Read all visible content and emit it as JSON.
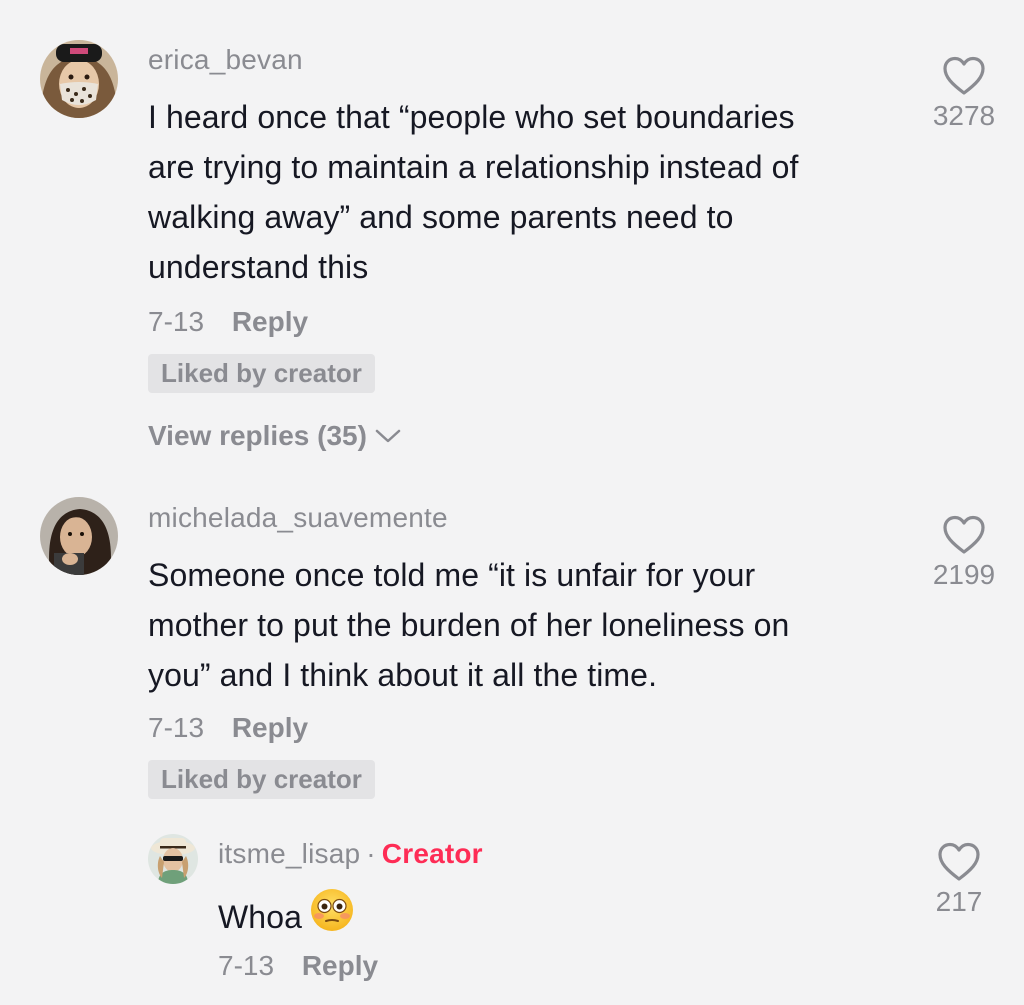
{
  "comments": [
    {
      "username": "erica_bevan",
      "text_lines": [
        "I heard once that “people who set boundaries",
        "are trying to maintain a relationship instead of",
        "walking away” and some parents need to",
        "understand this"
      ],
      "date": "7-13",
      "reply_label": "Reply",
      "liked_label": "Liked by creator",
      "view_replies_label": "View replies (35)",
      "like_count": "3278"
    },
    {
      "username": "michelada_suavemente",
      "text_lines": [
        "Someone once told me “it is unfair for your",
        "mother to put the burden of her loneliness on",
        "you” and I think about it all the time."
      ],
      "date": "7-13",
      "reply_label": "Reply",
      "liked_label": "Liked by creator",
      "like_count": "2199"
    }
  ],
  "reply": {
    "username": "itsme_lisap",
    "separator": "·",
    "creator_label": "Creator",
    "text": "Whoa",
    "emoji": "flushed-face-emoji",
    "date": "7-13",
    "reply_label": "Reply",
    "like_count": "217"
  },
  "colors": {
    "background": "#f3f3f4",
    "text_primary": "#161823",
    "text_secondary": "#8a8b91",
    "creator_accent": "#fe2c55",
    "badge_bg": "#e3e3e5"
  }
}
